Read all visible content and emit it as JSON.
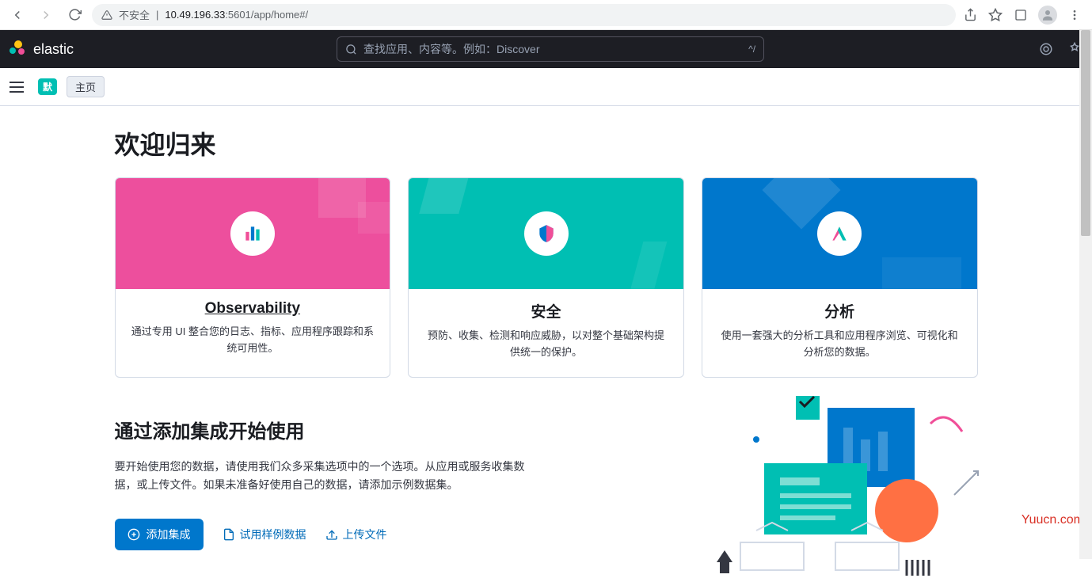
{
  "browser": {
    "insecure_label": "不安全",
    "url_host": "10.49.196.33",
    "url_port": ":5601",
    "url_path": "/app/home#/"
  },
  "header": {
    "brand": "elastic",
    "search_placeholder": "查找应用、内容等。例如：Discover",
    "search_shortcut": "^/"
  },
  "subheader": {
    "space_badge": "默",
    "breadcrumb": "主页"
  },
  "welcome": {
    "title": "欢迎归来"
  },
  "cards": [
    {
      "title": "Observability",
      "desc": "通过专用 UI 整合您的日志、指标、应用程序跟踪和系统可用性。"
    },
    {
      "title": "安全",
      "desc": "预防、收集、检测和响应威胁，以对整个基础架构提供统一的保护。"
    },
    {
      "title": "分析",
      "desc": "使用一套强大的分析工具和应用程序浏览、可视化和分析您的数据。"
    }
  ],
  "integrations": {
    "title": "通过添加集成开始使用",
    "desc": "要开始使用您的数据，请使用我们众多采集选项中的一个选项。从应用或服务收集数据，或上传文件。如果未准备好使用自己的数据，请添加示例数据集。",
    "add_btn": "添加集成",
    "sample_btn": "试用样例数据",
    "upload_btn": "上传文件"
  },
  "watermark": "Yuucn.com"
}
